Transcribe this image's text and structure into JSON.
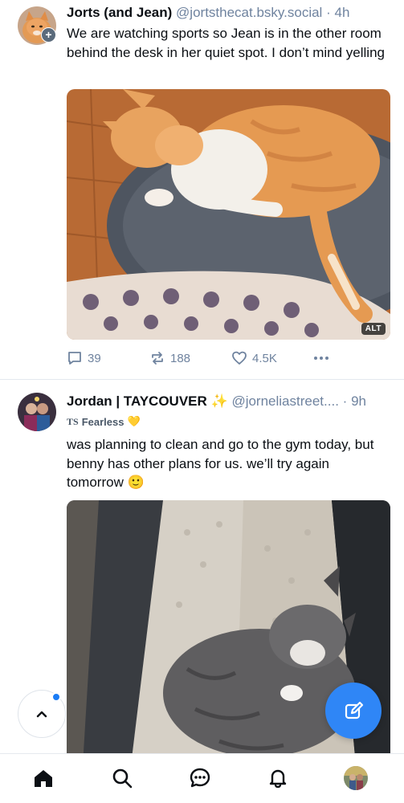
{
  "posts": [
    {
      "author_name": "Jorts (and Jean)",
      "handle": "@jortsthecat.bsky.social",
      "separator": "·",
      "time": "4h",
      "text": "We are watching sports so Jean is in the other room behind the desk in her quiet spot. I don’t mind yelling",
      "alt_badge": "ALT",
      "replies": "39",
      "reposts": "188",
      "likes": "4.5K"
    },
    {
      "author_name": "Jordan | TAYCOUVER",
      "name_emoji": "✨",
      "handle": "@jorneliastreet....",
      "separator": "·",
      "time": "9h",
      "badge_prefix": "TS",
      "badge_label": "Fearless",
      "badge_emoji": "💛",
      "text": "was planning to clean and go to the gym today, but benny has other plans for us. we’ll try again tomorrow",
      "text_emoji": "🙂"
    }
  ],
  "icons": {
    "reply": "speech-bubble-icon",
    "repost": "repost-arrows-icon",
    "like": "heart-icon",
    "more": "ellipsis-icon",
    "scroll_top": "chevron-up-icon",
    "compose": "compose-pencil-icon",
    "home": "home-icon",
    "search": "search-icon",
    "chat": "chat-icon",
    "notifications": "bell-icon",
    "profile": "avatar"
  },
  "colors": {
    "accent": "#2f86f6",
    "muted": "#6f839f",
    "text": "#0b0f14",
    "unread_dot": "#1a7cf5"
  }
}
